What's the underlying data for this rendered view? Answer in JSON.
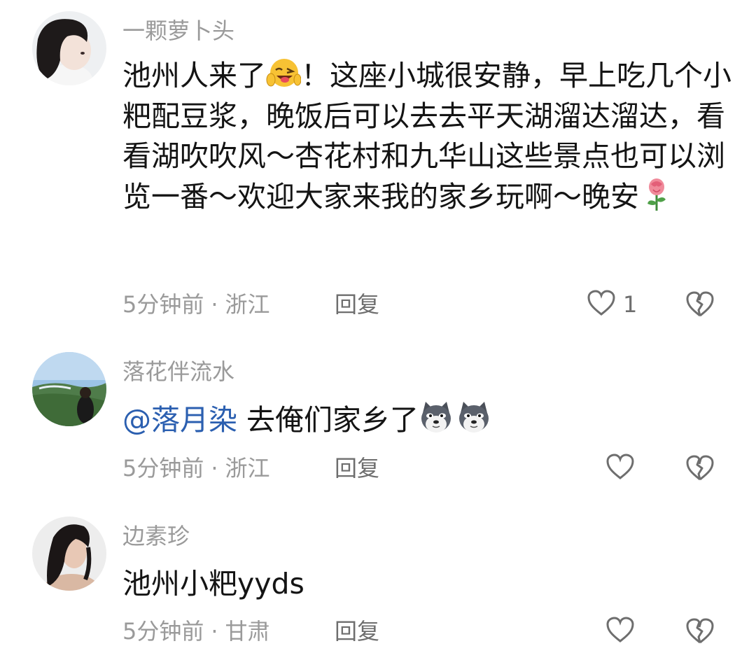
{
  "comments": [
    {
      "username": "一颗萝卜头",
      "text_parts": [
        "池州人来了",
        "！这座小城很安静，早上吃几个小粑配豆浆，晚饭后可以去去平天湖溜达溜达，看看湖吹吹风～杏花村和九华山这些景点也可以浏览一番～欢迎大家来我的家乡玩啊～晚安"
      ],
      "emojis": [
        "wink-tongue-emoji",
        "rose-emoji"
      ],
      "time": "5分钟前",
      "dot": "·",
      "location": "浙江",
      "reply_label": "回复",
      "like_count": "1"
    },
    {
      "username": "落花伴流水",
      "mention": "@落月染",
      "text": " 去俺们家乡了",
      "emojis": [
        "doge-emoji",
        "doge-emoji"
      ],
      "time": "5分钟前",
      "dot": "·",
      "location": "浙江",
      "reply_label": "回复"
    },
    {
      "username": "边素珍",
      "text": "池州小粑yyds",
      "time": "5分钟前",
      "dot": "·",
      "location": "甘肃",
      "reply_label": "回复"
    }
  ],
  "icons": {
    "like": "heart-outline-icon",
    "dislike": "broken-heart-outline-icon"
  },
  "colors": {
    "meta_gray": "#9a9a9a",
    "action_gray": "#6e6e6e",
    "mention_blue": "#2b5fb0"
  }
}
